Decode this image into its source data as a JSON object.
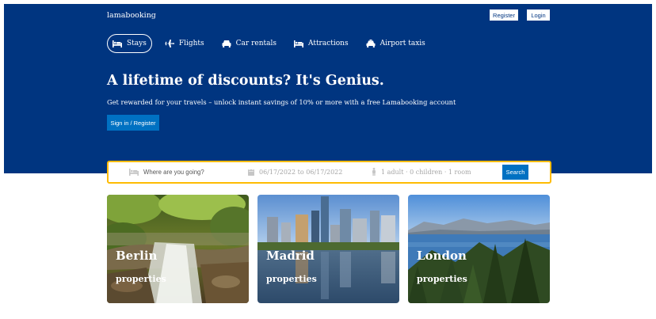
{
  "header": {
    "logo": "lamabooking",
    "register_label": "Register",
    "login_label": "Login"
  },
  "nav": {
    "items": [
      {
        "label": "Stays",
        "icon": "bed-icon",
        "active": true
      },
      {
        "label": "Flights",
        "icon": "plane-icon",
        "active": false
      },
      {
        "label": "Car rentals",
        "icon": "car-icon",
        "active": false
      },
      {
        "label": "Attractions",
        "icon": "bed-icon",
        "active": false
      },
      {
        "label": "Airport taxis",
        "icon": "taxi-icon",
        "active": false
      }
    ]
  },
  "hero": {
    "title": "A lifetime of discounts? It's Genius.",
    "description": "Get rewarded for your travels – unlock instant savings of 10% or more with a free Lamabooking account",
    "signin_label": "Sign in / Register"
  },
  "search": {
    "destination_placeholder": "Where are you going?",
    "dates": "06/17/2022 to 06/17/2022",
    "guests": "1 adult · 0 children · 1 room",
    "button_label": "Search"
  },
  "cities": [
    {
      "name": "Berlin",
      "subtitle": "properties"
    },
    {
      "name": "Madrid",
      "subtitle": "properties"
    },
    {
      "name": "London",
      "subtitle": "properties"
    }
  ],
  "colors": {
    "header_bg": "#003580",
    "accent_blue": "#0071c2",
    "search_border": "#febb02"
  }
}
